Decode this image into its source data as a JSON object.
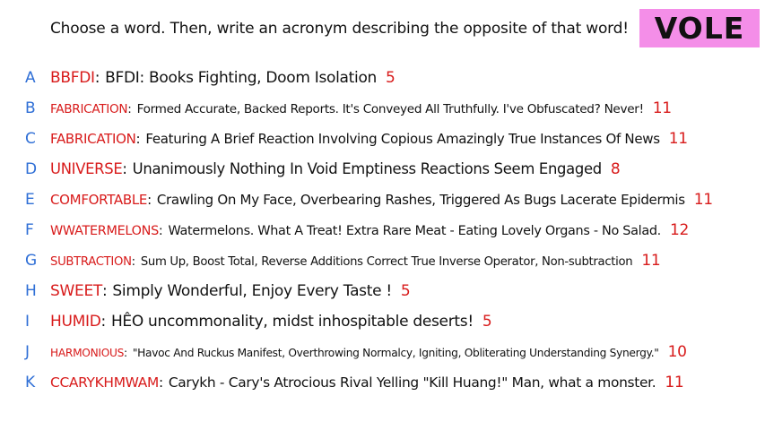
{
  "header": {
    "prompt": "Choose a word. Then, write an acronym describing the opposite of that word!",
    "word": "VOLE"
  },
  "entries": [
    {
      "letter": "A",
      "word": "BBFDI",
      "text": "BFDI: Books Fighting, Doom Isolation",
      "score": "5"
    },
    {
      "letter": "B",
      "word": "FABRICATION",
      "text": "Formed Accurate, Backed Reports. It's Conveyed All Truthfully. I've Obfuscated? Never!",
      "score": "11"
    },
    {
      "letter": "C",
      "word": "FABRICATION",
      "text": "Featuring A Brief Reaction Involving Copious Amazingly True Instances Of News",
      "score": "11"
    },
    {
      "letter": "D",
      "word": "UNIVERSE",
      "text": "Unanimously Nothing In Void Emptiness Reactions Seem Engaged",
      "score": "8"
    },
    {
      "letter": "E",
      "word": "COMFORTABLE",
      "text": "Crawling On My Face, Overbearing Rashes, Triggered As Bugs Lacerate Epidermis",
      "score": "11"
    },
    {
      "letter": "F",
      "word": "WWATERMELONS",
      "text": "Watermelons. What A Treat! Extra Rare Meat - Eating Lovely Organs - No Salad.",
      "score": "12"
    },
    {
      "letter": "G",
      "word": "SUBTRACTION",
      "text": "Sum Up, Boost Total, Reverse Additions Correct True Inverse Operator, Non-subtraction",
      "score": "11"
    },
    {
      "letter": "H",
      "word": "SWEET",
      "text": "Simply Wonderful, Enjoy Every Taste !",
      "score": "5"
    },
    {
      "letter": "I",
      "word": "HUMID",
      "text": "HÊO uncommonality, midst inhospitable deserts!",
      "score": "5"
    },
    {
      "letter": "J",
      "word": "HARMONIOUS",
      "text": "\"Havoc And Ruckus Manifest, Overthrowing Normalcy, Igniting, Obliterating Understanding Synergy.\"",
      "score": "10"
    },
    {
      "letter": "K",
      "word": "CCARYKHMWAM",
      "text": "Carykh - Cary's Atrocious Rival Yelling \"Kill Huang!\" Man, what a monster.",
      "score": "11"
    }
  ]
}
